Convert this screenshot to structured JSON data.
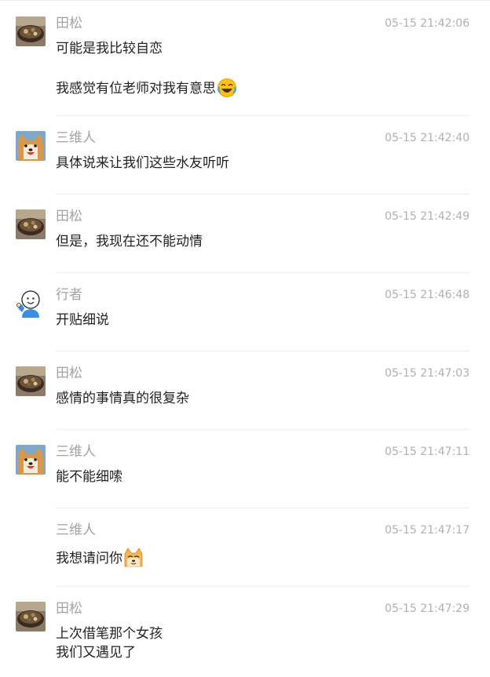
{
  "avatars": {
    "tiansong": "bowl-food-photo",
    "sanweiren": "shiba-dog-photo",
    "xingzhe": "cartoon-waving-person"
  },
  "messages": [
    {
      "author": "田松",
      "time": "05-15 21:42:06",
      "avatar": "tiansong",
      "lines": [
        "可能是我比较自恋",
        "我感觉有位老师对我有意思"
      ],
      "emoji": "rolling-laugh-emoji"
    },
    {
      "author": "三维人",
      "time": "05-15 21:42:40",
      "avatar": "sanweiren",
      "lines": [
        "具体说来让我们这些水友听听"
      ]
    },
    {
      "author": "田松",
      "time": "05-15 21:42:49",
      "avatar": "tiansong",
      "lines": [
        "但是，我现在还不能动情"
      ]
    },
    {
      "author": "行者",
      "time": "05-15 21:46:48",
      "avatar": "xingzhe",
      "lines": [
        "开贴细说"
      ]
    },
    {
      "author": "田松",
      "time": "05-15 21:47:03",
      "avatar": "tiansong",
      "lines": [
        "感情的事情真的很复杂"
      ]
    },
    {
      "author": "三维人",
      "time": "05-15 21:47:11",
      "avatar": "sanweiren",
      "lines": [
        "能不能细嗦"
      ]
    },
    {
      "author": "三维人",
      "time": "05-15 21:47:17",
      "avatar": "",
      "lines": [
        "我想请问你"
      ],
      "emoji": "doge-emoji"
    },
    {
      "author": "田松",
      "time": "05-15 21:47:29",
      "avatar": "tiansong",
      "lines": [
        "上次借笔那个女孩",
        "我们又遇见了"
      ]
    }
  ]
}
